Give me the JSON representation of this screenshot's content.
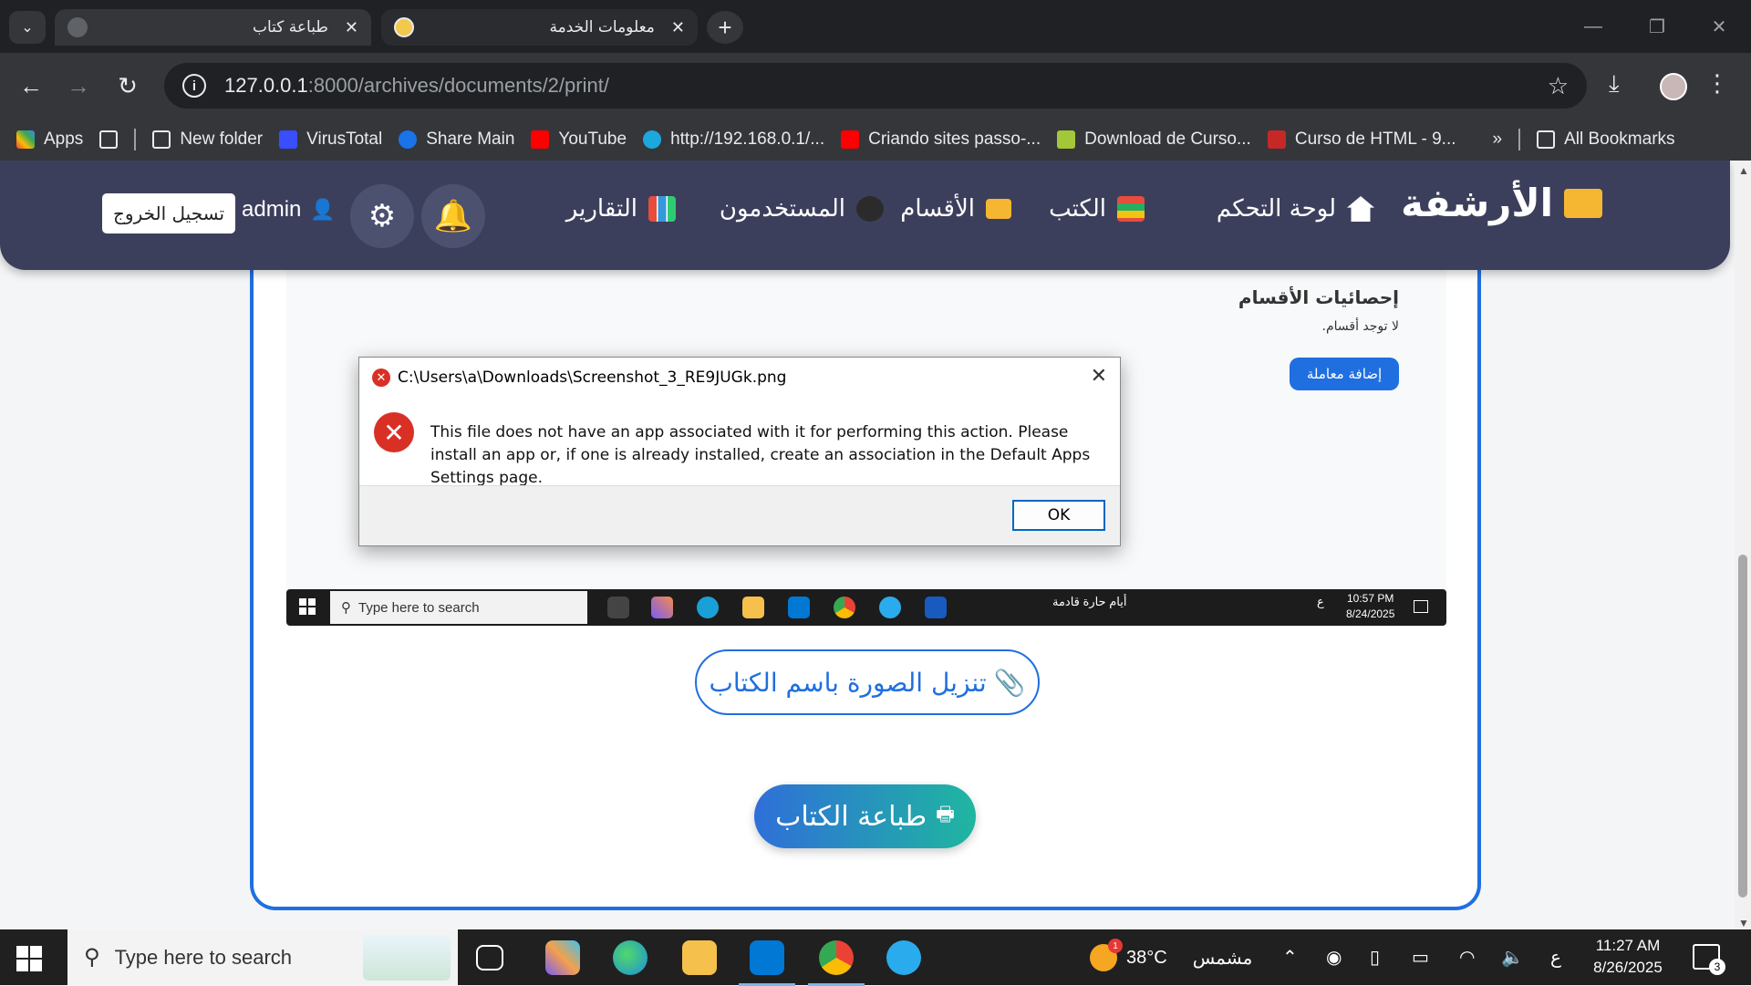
{
  "browser": {
    "tabs": [
      {
        "title": "طباعة كتاب",
        "active": true
      },
      {
        "title": "معلومات الخدمة",
        "active": false
      }
    ],
    "url_host": "127.0.0.1",
    "url_path": ":8000/archives/documents/2/print/",
    "bookmarks": [
      {
        "label": "Apps",
        "icon": "apps-grid-icon"
      },
      {
        "label": "New folder",
        "icon": "folder-icon"
      },
      {
        "label": "VirusTotal",
        "icon": "virustotal-icon"
      },
      {
        "label": "Share Main",
        "icon": "share-icon"
      },
      {
        "label": "YouTube",
        "icon": "youtube-icon"
      },
      {
        "label": "http://192.168.0.1/...",
        "icon": "router-icon"
      },
      {
        "label": "Criando sites passo-...",
        "icon": "youtube-icon"
      },
      {
        "label": "Download de Curso...",
        "icon": "download-icon"
      },
      {
        "label": "Curso de HTML - 9...",
        "icon": "html-icon"
      }
    ],
    "all_bookmarks": "All Bookmarks"
  },
  "navbar": {
    "brand": "الأرشفة",
    "items": [
      {
        "label": "لوحة التحكم",
        "icon": "home-icon"
      },
      {
        "label": "الكتب",
        "icon": "books-icon"
      },
      {
        "label": "الأقسام",
        "icon": "folder-icon"
      },
      {
        "label": "المستخدمون",
        "icon": "users-icon"
      },
      {
        "label": "التقارير",
        "icon": "chart-icon"
      }
    ],
    "username": "admin",
    "logout": "تسجيل الخروج"
  },
  "content": {
    "section_title": "إحصائيات الأقسام",
    "section_empty": "لا توجد أقسام.",
    "add_button": "إضافة معاملة",
    "download_button": "تنزيل الصورة باسم الكتاب",
    "print_button": "طباعة الكتاب"
  },
  "mini_taskbar": {
    "search": "Type here to search",
    "weather": "أيام حارة قادمة",
    "time": "10:57 PM",
    "date": "8/24/2025",
    "lang": "ع"
  },
  "dialog": {
    "title": "C:\\Users\\a\\Downloads\\Screenshot_3_RE9JUGk.png",
    "message": "This file does not have an app associated with it for performing this action. Please install an app or, if one is already installed, create an association in the Default Apps Settings page.",
    "ok": "OK"
  },
  "taskbar": {
    "search": "Type here to search",
    "temperature": "38°C",
    "weather": "مشمس",
    "weather_badge": "1",
    "lang": "ع",
    "time": "11:27 AM",
    "date": "8/26/2025",
    "notifications": "3"
  },
  "colors": {
    "accent": "#1f6fe0",
    "navbar": "#3c3f5c",
    "error": "#d93025"
  }
}
